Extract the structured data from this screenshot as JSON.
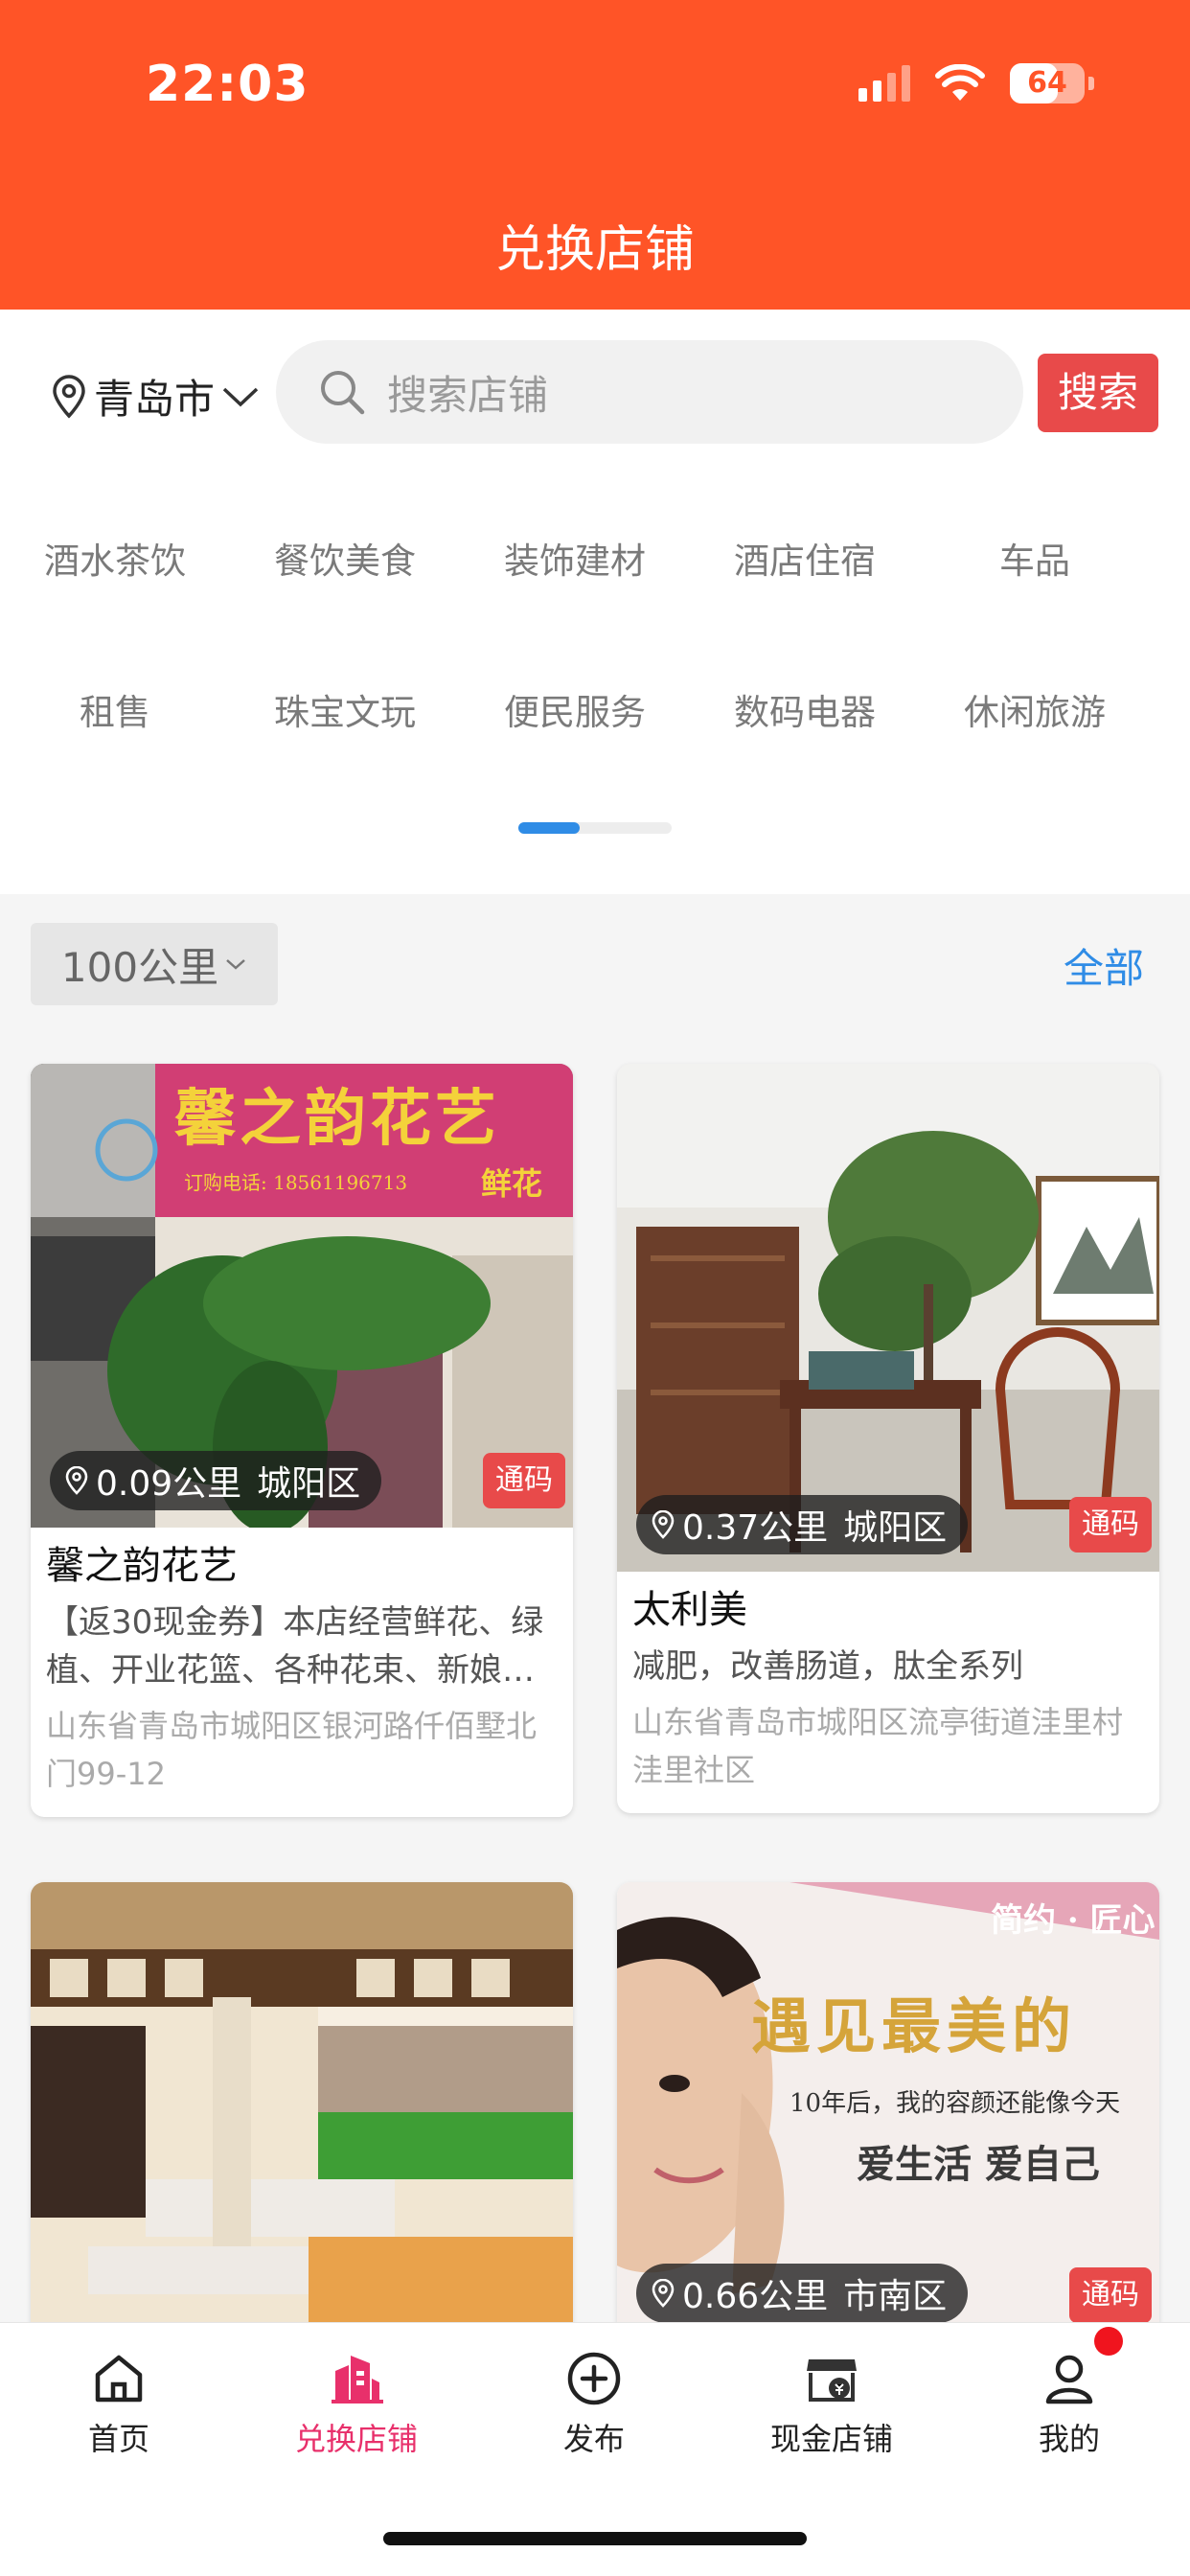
{
  "status": {
    "time": "22:03",
    "battery": "64"
  },
  "header": {
    "title": "兑换店铺"
  },
  "search": {
    "city": "青岛市",
    "placeholder": "搜索店铺",
    "button": "搜索"
  },
  "categories": {
    "row1": [
      "酒水茶饮",
      "餐饮美食",
      "装饰建材",
      "酒店住宿",
      "车品"
    ],
    "row2": [
      "租售",
      "珠宝文玩",
      "便民服务",
      "数码电器",
      "休闲旅游"
    ]
  },
  "filter": {
    "distance": "100公里",
    "all": "全部"
  },
  "stores": [
    {
      "distance": "0.09公里",
      "district": "城阳区",
      "tag": "通码",
      "name": "馨之韵花艺",
      "desc": "【返30现金券】本店经营鲜花、绿植、开业花篮、各种花束、新娘…",
      "address": "山东省青岛市城阳区银河路仟佰墅北门99-12",
      "sign_text": "馨之韵花艺",
      "phone_text": "订购电话: 18561196713",
      "sign_sub": "鲜花"
    },
    {
      "distance": "0.37公里",
      "district": "城阳区",
      "tag": "通码",
      "name": "太利美",
      "desc": "减肥，改善肠道，肽全系列",
      "address": "山东省青岛市城阳区流亭街道洼里村洼里社区"
    },
    {
      "distance": "",
      "district": "",
      "tag": "",
      "name": "",
      "desc": "",
      "address": ""
    },
    {
      "distance": "0.66公里",
      "district": "市南区",
      "tag": "通码",
      "poster_title": "遇见最美的",
      "poster_corner": "简约 · 匠心",
      "poster_line1": "10年后，我的容颜还能像今天",
      "poster_line2": "爱生活 爱自己"
    }
  ],
  "tabs": [
    {
      "label": "首页",
      "icon": "home-icon"
    },
    {
      "label": "兑换店铺",
      "icon": "building-icon"
    },
    {
      "label": "发布",
      "icon": "plus-circle-icon"
    },
    {
      "label": "现金店铺",
      "icon": "cash-store-icon"
    },
    {
      "label": "我的",
      "icon": "user-icon"
    }
  ],
  "colors": {
    "header": "#FF5427",
    "accent_red": "#E84A4A",
    "accent_blue": "#2F8CE6",
    "active_tab": "#E8306B"
  }
}
